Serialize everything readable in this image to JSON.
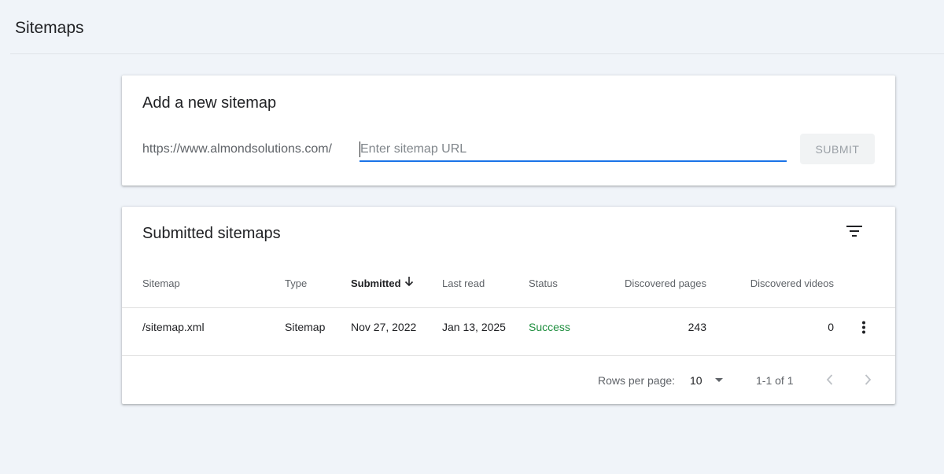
{
  "page": {
    "title": "Sitemaps"
  },
  "add_card": {
    "title": "Add a new sitemap",
    "url_prefix": "https://www.almondsolutions.com/",
    "input_value": "",
    "input_placeholder": "Enter sitemap URL",
    "submit_label": "SUBMIT"
  },
  "submitted_card": {
    "title": "Submitted sitemaps",
    "columns": {
      "sitemap": "Sitemap",
      "type": "Type",
      "submitted": "Submitted",
      "last_read": "Last read",
      "status": "Status",
      "discovered_pages": "Discovered pages",
      "discovered_videos": "Discovered videos"
    },
    "sorted_column": "submitted",
    "sort_direction": "descending",
    "rows": [
      {
        "sitemap": "/sitemap.xml",
        "type": "Sitemap",
        "submitted": "Nov 27, 2022",
        "last_read": "Jan 13, 2025",
        "status": "Success",
        "discovered_pages": "243",
        "discovered_videos": "0"
      }
    ],
    "footer": {
      "rows_per_page_label": "Rows per page:",
      "rows_per_page_value": "10",
      "range_label": "1-1 of 1"
    }
  },
  "icons": {
    "filter": "filter-list-icon",
    "sort": "arrow-down-icon",
    "more": "more-vert-icon",
    "dropdown": "caret-down-icon",
    "prev": "chevron-left-icon",
    "next": "chevron-right-icon"
  },
  "colors": {
    "background": "#f0f4f9",
    "accent": "#1a73e8",
    "success": "#1e8e3e",
    "disabled_button_bg": "#f1f3f4",
    "disabled_button_text": "#9aa0a6"
  }
}
